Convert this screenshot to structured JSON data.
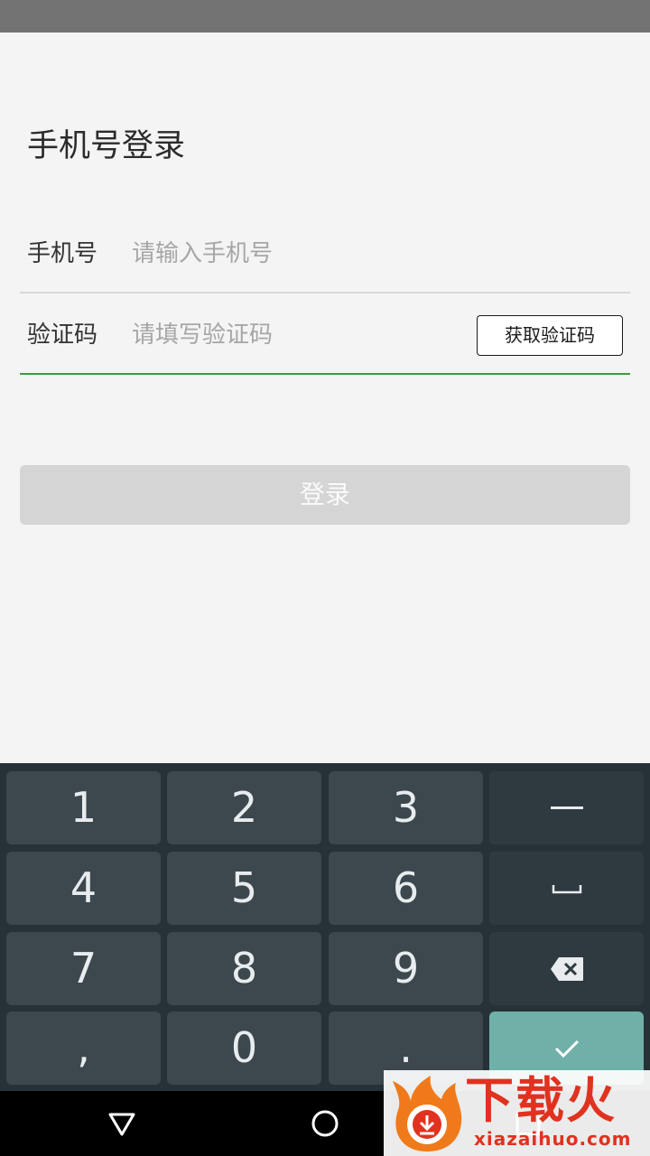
{
  "page": {
    "title": "手机号登录"
  },
  "form": {
    "phone": {
      "label": "手机号",
      "placeholder": "请输入手机号",
      "value": ""
    },
    "code": {
      "label": "验证码",
      "placeholder": "请填写验证码",
      "value": ""
    },
    "get_code_label": "获取验证码",
    "login_label": "登录"
  },
  "keyboard": {
    "keys": [
      "1",
      "2",
      "3",
      "—",
      "4",
      "5",
      "6",
      "space",
      "7",
      "8",
      "9",
      "backspace",
      ",",
      "0",
      ".",
      "enter"
    ],
    "labels": {
      "k1": "1",
      "k2": "2",
      "k3": "3",
      "k4": "4",
      "k5": "5",
      "k6": "6",
      "k7": "7",
      "k8": "8",
      "k9": "9",
      "comma": ",",
      "k0": "0",
      "dot": "."
    },
    "icons": {
      "dash": "minus-icon",
      "space": "space-bar-icon",
      "backspace": "backspace-icon",
      "enter": "check-icon"
    },
    "colors": {
      "background": "#263238",
      "key": "#3c474e",
      "enter": "#6fb0a8"
    }
  },
  "navigation": {
    "icons": [
      "back-triangle-icon",
      "home-circle-icon",
      "recents-square-icon"
    ]
  },
  "watermark": {
    "text": "下载火",
    "url": "xiazaihuo.com",
    "icon": "flame-logo-icon"
  },
  "colors": {
    "background": "#f4f4f4",
    "focused_underline": "#3e9a3e",
    "login_disabled": "#d5d5d5"
  }
}
